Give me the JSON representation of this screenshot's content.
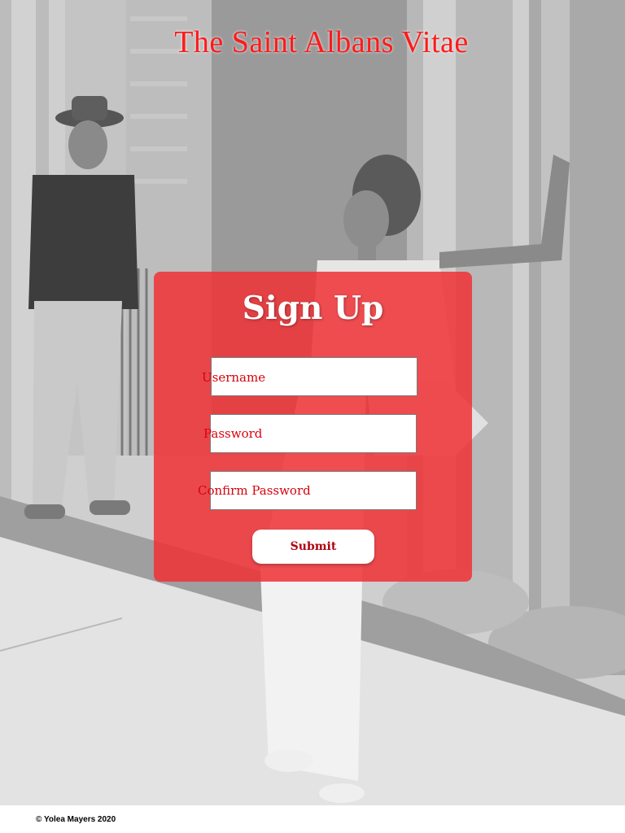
{
  "site": {
    "title": "The Saint Albans Vitae"
  },
  "signup": {
    "heading": "Sign Up",
    "fields": {
      "username": {
        "label": "Username",
        "value": ""
      },
      "password": {
        "label": "Password",
        "value": ""
      },
      "confirm_password": {
        "label": "Confirm Password",
        "value": ""
      }
    },
    "submit_label": "Submit"
  },
  "footer": {
    "copyright": "© Yolea Mayers 2020"
  },
  "colors": {
    "title": "#ff1a1a",
    "card": "#f03237",
    "label": "#d8000c",
    "submit_text": "#b00010"
  },
  "background": {
    "image": "black-and-white-street-photo-icon"
  }
}
